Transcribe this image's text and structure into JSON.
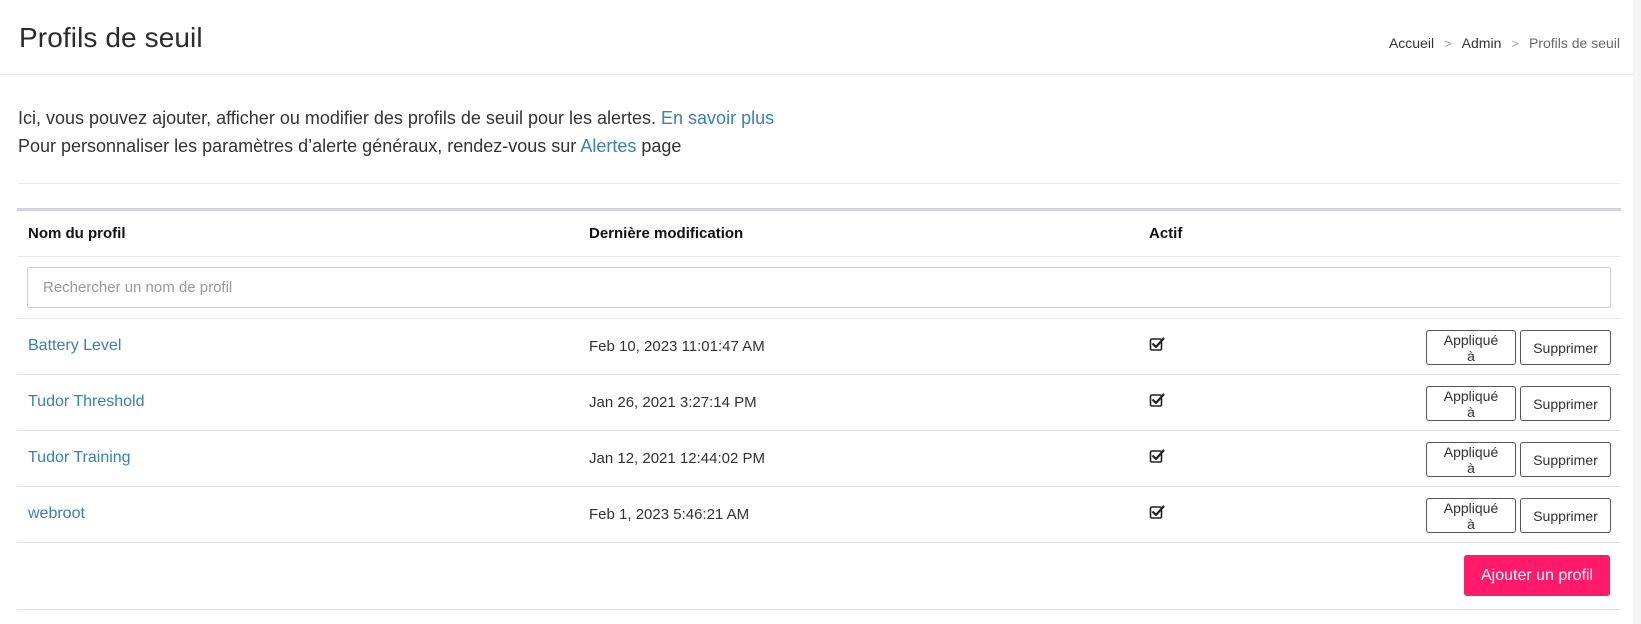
{
  "header": {
    "title": "Profils de seuil",
    "breadcrumb": [
      "Accueil",
      "Admin",
      "Profils de seuil"
    ],
    "separator": ">"
  },
  "intro": {
    "line1_text": "Ici, vous pouvez ajouter, afficher ou modifier des profils de seuil pour les alertes.",
    "line1_link": "En savoir plus",
    "line2_text": "Pour personnaliser les paramètres d’alerte généraux, rendez-vous sur",
    "line2_link": "Alertes",
    "line2_suffix": "page"
  },
  "table": {
    "columns": [
      "Nom du profil",
      "Dernière modification",
      "Actif"
    ],
    "search_placeholder": "Rechercher un nom de profil",
    "rows": [
      {
        "name": "Battery Level",
        "modified": "Feb 10, 2023 11:01:47 AM",
        "active": true
      },
      {
        "name": "Tudor Threshold",
        "modified": "Jan 26, 2021 3:27:14 PM",
        "active": true
      },
      {
        "name": "Tudor Training",
        "modified": "Jan 12, 2021 12:44:02 PM",
        "active": true
      },
      {
        "name": "webroot",
        "modified": "Feb 1, 2023 5:46:21 AM",
        "active": true
      }
    ],
    "applied_label": "Appliqué à",
    "delete_label": "Supprimer",
    "active_icon": "checked-checkbox-icon"
  },
  "actions": {
    "add_profile_label": "Ajouter un profil"
  },
  "colors": {
    "link": "#3a7fb6",
    "primary": "#ff1a6a",
    "table_top_border": "#d4d4e0"
  }
}
